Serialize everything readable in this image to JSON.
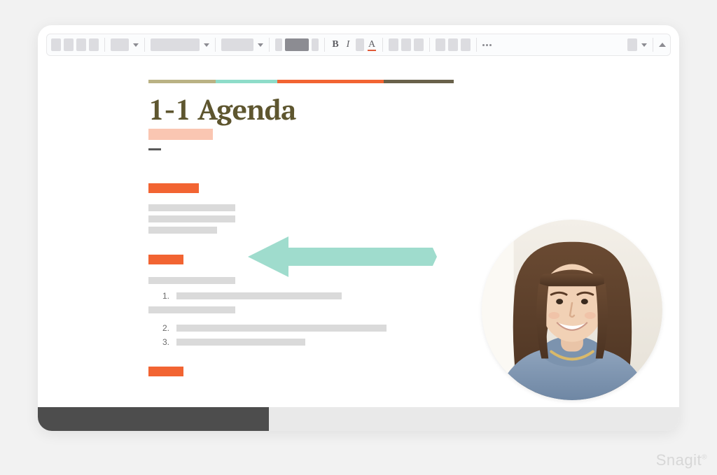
{
  "window": {
    "title": "1-1 Agenda"
  },
  "toolbar": {
    "bold_label": "B",
    "italic_label": "I",
    "color_label": "A"
  },
  "document": {
    "title": "1-1 Agenda",
    "stripe_colors": [
      "#bab284",
      "#8edcc9",
      "#f26432",
      "#69614a"
    ],
    "stripe_widths": [
      96,
      88,
      152,
      100
    ],
    "list_numbers": [
      "1.",
      "2.",
      "3."
    ]
  },
  "annotation": {
    "arrow_color": "#9fdccd",
    "avatar_alt": "presenter-webcam"
  },
  "watermark": "Snagit"
}
